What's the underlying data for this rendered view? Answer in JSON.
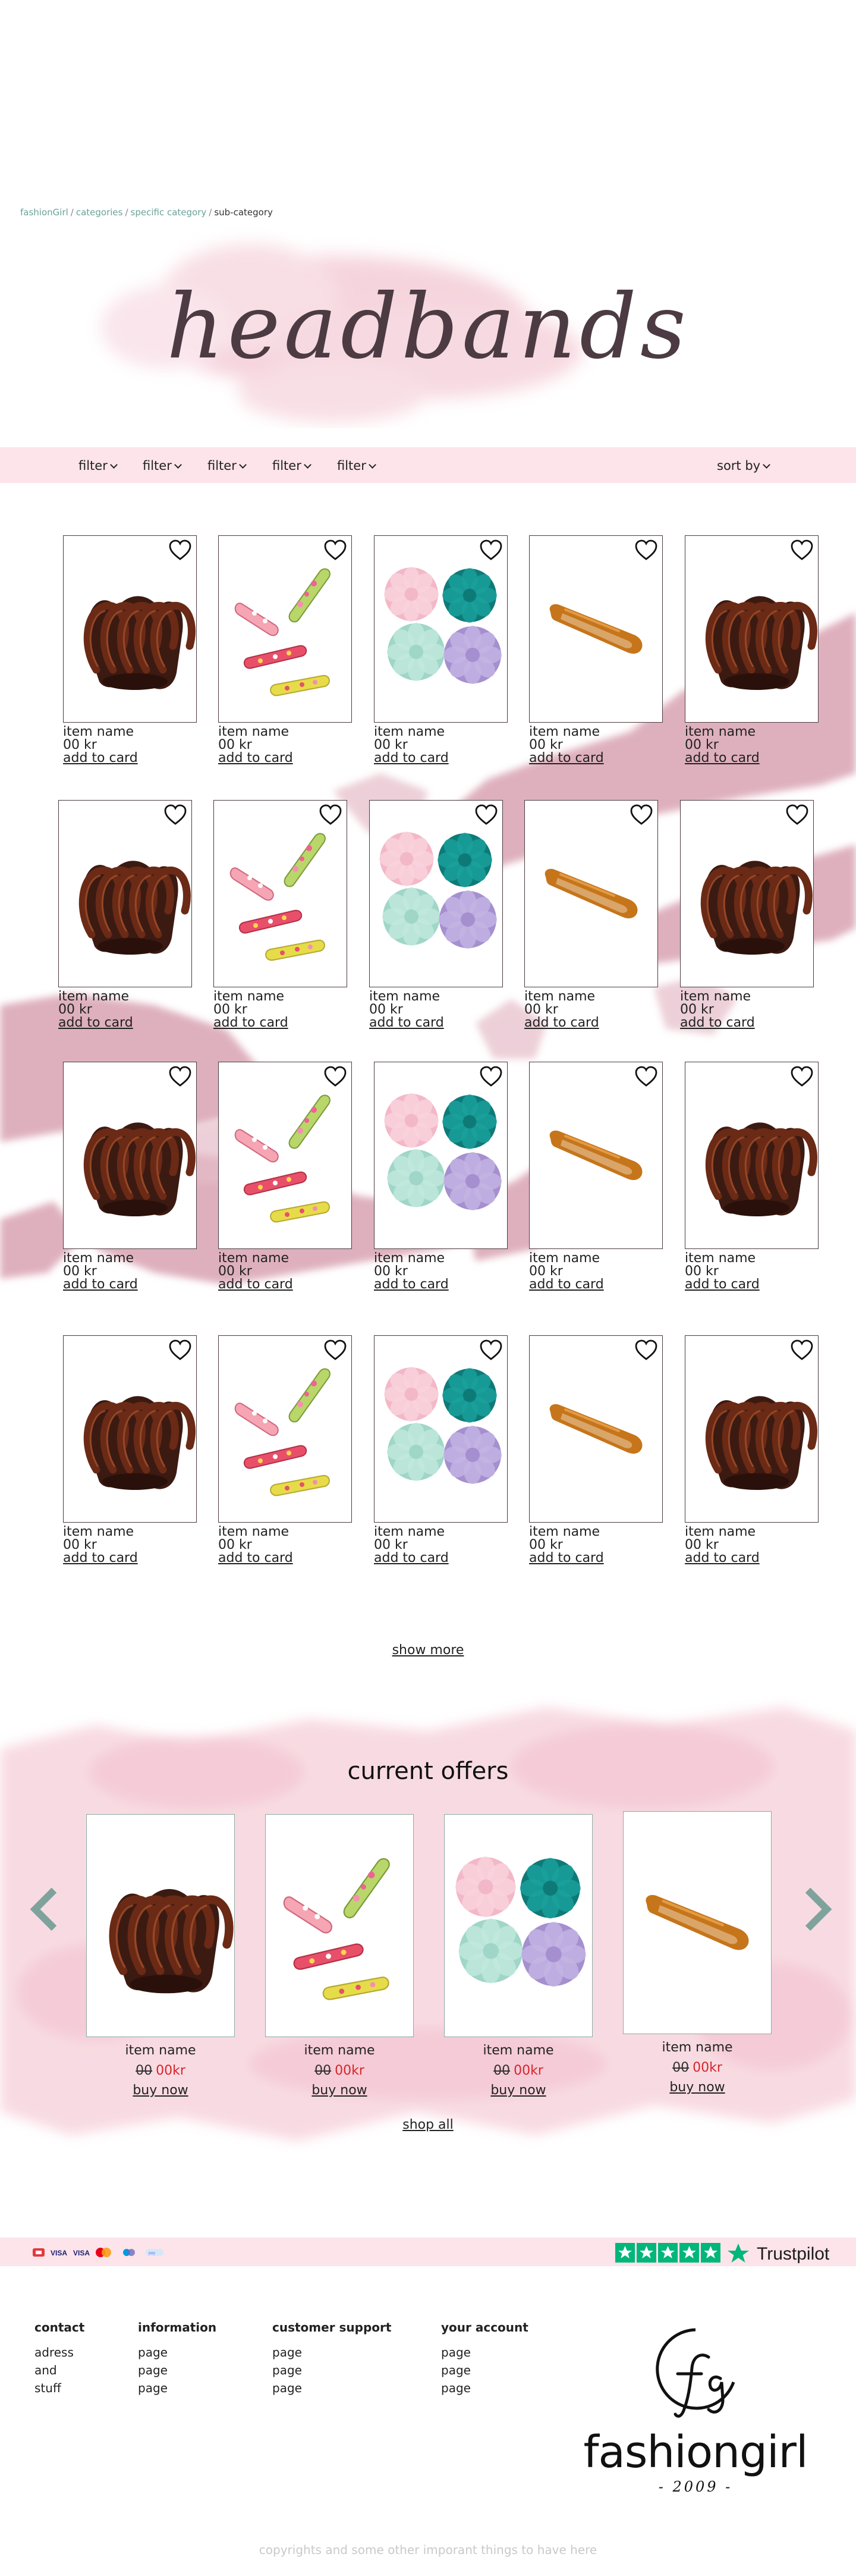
{
  "breadcrumb": {
    "home": "fashionGirl",
    "categories": "categories",
    "specific": "specific category",
    "current": "sub-category"
  },
  "hero": {
    "title": "headbands"
  },
  "filters": [
    "filter",
    "filter",
    "filter",
    "filter",
    "filter"
  ],
  "sort_label": "sort by",
  "products": [
    {
      "image": "claw-clip",
      "name": "item name",
      "price": "00 kr",
      "action": "add to card"
    },
    {
      "image": "snap-clips",
      "name": "item name",
      "price": "00 kr",
      "action": "add to card"
    },
    {
      "image": "scrunchies",
      "name": "item name",
      "price": "00 kr",
      "action": "add to card"
    },
    {
      "image": "snap-clip-orange",
      "name": "item name",
      "price": "00 kr",
      "action": "add to card"
    },
    {
      "image": "claw-clip",
      "name": "item name",
      "price": "00 kr",
      "action": "add to card"
    },
    {
      "image": "claw-clip",
      "name": "item name",
      "price": "00 kr",
      "action": "add to card"
    },
    {
      "image": "snap-clips",
      "name": "item name",
      "price": "00 kr",
      "action": "add to card"
    },
    {
      "image": "scrunchies",
      "name": "item name",
      "price": "00 kr",
      "action": "add to card"
    },
    {
      "image": "snap-clip-orange",
      "name": "item name",
      "price": "00 kr",
      "action": "add to card"
    },
    {
      "image": "claw-clip",
      "name": "item name",
      "price": "00 kr",
      "action": "add to card"
    },
    {
      "image": "claw-clip",
      "name": "item name",
      "price": "00 kr",
      "action": "add to card"
    },
    {
      "image": "snap-clips",
      "name": "item name",
      "price": "00 kr",
      "action": "add to card"
    },
    {
      "image": "scrunchies",
      "name": "item name",
      "price": "00 kr",
      "action": "add to card"
    },
    {
      "image": "snap-clip-orange",
      "name": "item name",
      "price": "00 kr",
      "action": "add to card"
    },
    {
      "image": "claw-clip",
      "name": "item name",
      "price": "00 kr",
      "action": "add to card"
    },
    {
      "image": "claw-clip",
      "name": "item name",
      "price": "00 kr",
      "action": "add to card"
    },
    {
      "image": "snap-clips",
      "name": "item name",
      "price": "00 kr",
      "action": "add to card"
    },
    {
      "image": "scrunchies",
      "name": "item name",
      "price": "00 kr",
      "action": "add to card"
    },
    {
      "image": "snap-clip-orange",
      "name": "item name",
      "price": "00 kr",
      "action": "add to card"
    },
    {
      "image": "claw-clip",
      "name": "item name",
      "price": "00 kr",
      "action": "add to card"
    }
  ],
  "show_more": "show more",
  "offers": {
    "title": "current offers",
    "items": [
      {
        "image": "claw-clip",
        "name": "item name",
        "old_price": "00",
        "new_price": "00kr",
        "action": "buy now"
      },
      {
        "image": "snap-clips",
        "name": "item name",
        "old_price": "00",
        "new_price": "00kr",
        "action": "buy now"
      },
      {
        "image": "scrunchies",
        "name": "item name",
        "old_price": "00",
        "new_price": "00kr",
        "action": "buy now"
      },
      {
        "image": "snap-clip-orange",
        "name": "item name",
        "old_price": "00",
        "new_price": "00kr",
        "action": "buy now"
      }
    ],
    "shop_all": "shop all"
  },
  "payment_icons": [
    "dankort-icon",
    "visa-icon",
    "visa-electron-icon",
    "mastercard-icon",
    "maestro-icon",
    "mobilepay-icon"
  ],
  "trustpilot": {
    "label": "Trustpilot",
    "stars": 5
  },
  "footer": {
    "columns": [
      {
        "title": "contact",
        "items": [
          "adress",
          "and",
          "stuff"
        ]
      },
      {
        "title": "information",
        "items": [
          "page",
          "page",
          "page"
        ]
      },
      {
        "title": "customer support",
        "items": [
          "page",
          "page",
          "page"
        ]
      },
      {
        "title": "your account",
        "items": [
          "page",
          "page",
          "page"
        ]
      }
    ],
    "logo": {
      "monogram": "fg",
      "name": "fashiongirl",
      "year": "- 2009 -"
    },
    "copyright": "copyrights and some other imporant things to have here"
  },
  "colors": {
    "accent_pink": "#fce4ea",
    "splash_pink": "#d9a3b2",
    "title": "#4c3b42",
    "arrow_teal": "#7fa39c",
    "sale_red": "#d6262c",
    "trustpilot_green": "#00b67a"
  }
}
